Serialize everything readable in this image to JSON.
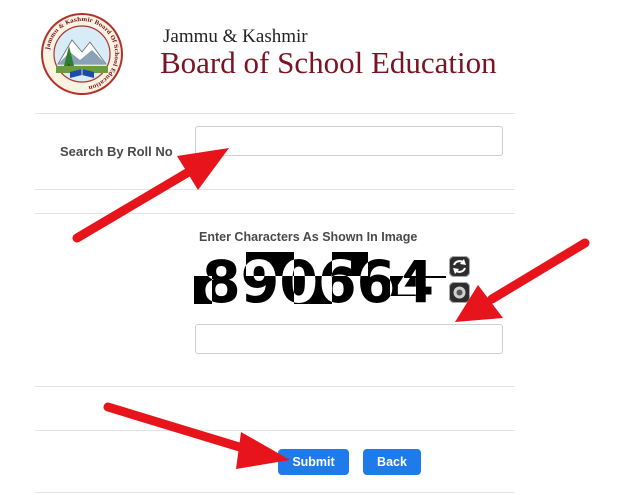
{
  "header": {
    "subtitle": "Jammu & Kashmir",
    "title": "Board of School Education",
    "logo": {
      "ring_text": "Jammu & Kashmir Board Of School Education"
    }
  },
  "form": {
    "roll_label": "Search By Roll No",
    "roll_value": "",
    "captcha_label": "Enter Characters As Shown In Image",
    "captcha_text": "890664",
    "captcha_value": "",
    "refresh_icon": "refresh-icon",
    "audio_icon": "audio-icon"
  },
  "buttons": {
    "submit": "Submit",
    "back": "Back"
  },
  "colors": {
    "title_maroon": "#7a1424",
    "button_blue": "#1f7bea",
    "arrow_red": "#e8141c"
  }
}
